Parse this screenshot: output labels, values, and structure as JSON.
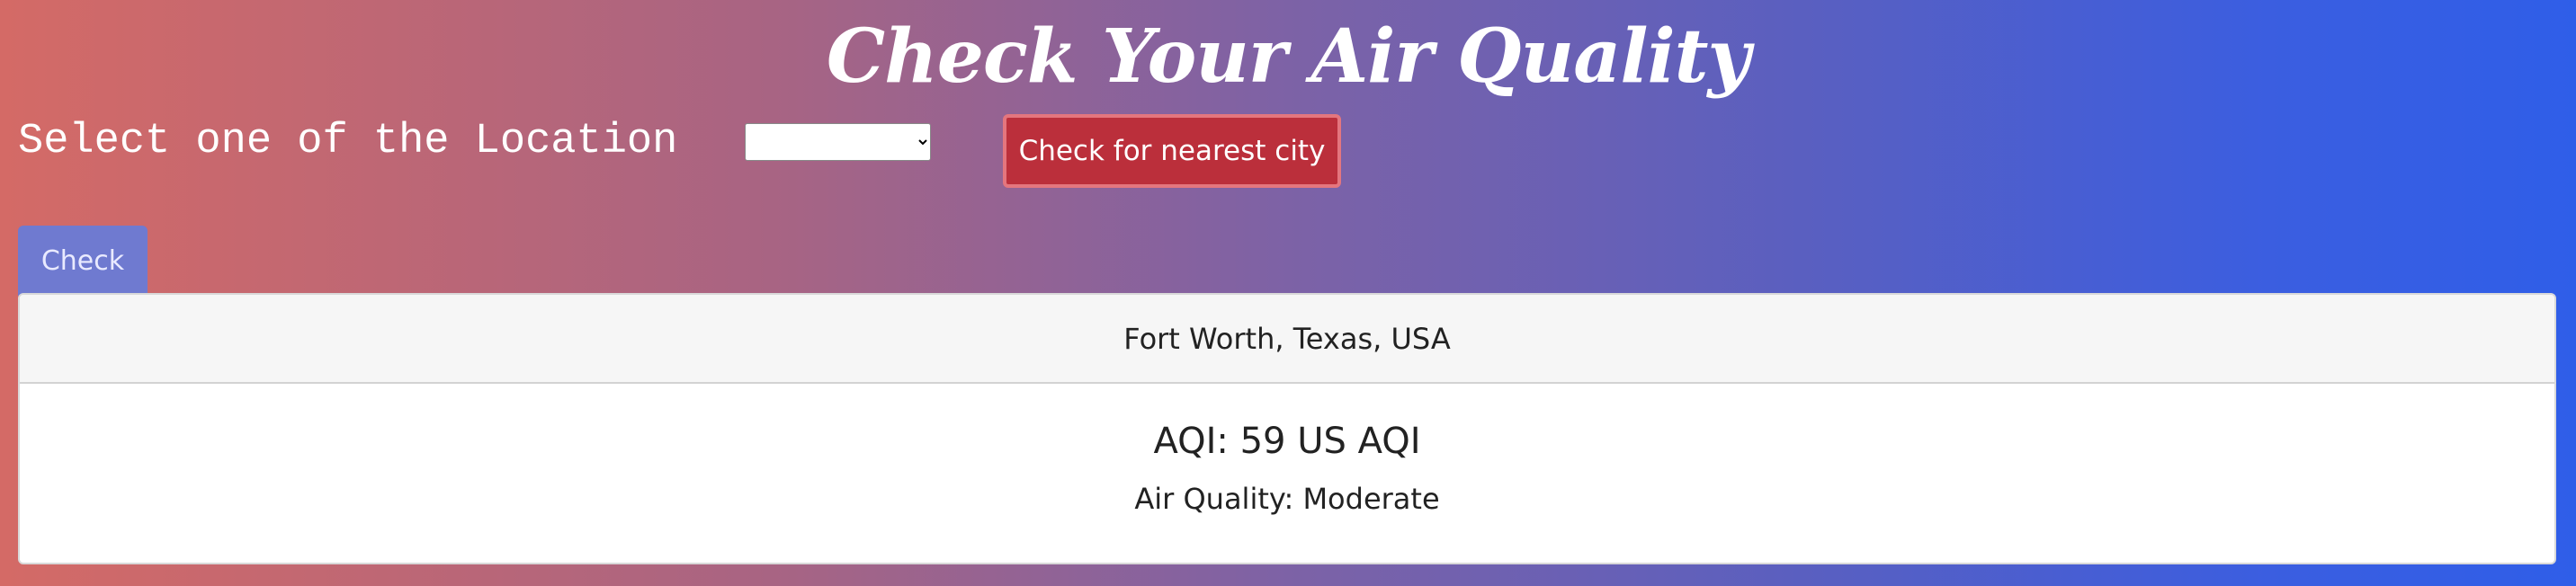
{
  "page": {
    "title": "Check Your Air Quality"
  },
  "controls": {
    "location_label": "Select one of the Location",
    "location_select": {
      "selected": "",
      "options": [
        ""
      ]
    },
    "nearest_button_label": "Check for nearest city",
    "check_button_label": "Check"
  },
  "result": {
    "location": "Fort Worth, Texas, USA",
    "aqi_text": "AQI: 59 US AQI",
    "quality_text": "Air Quality: Moderate"
  },
  "colors": {
    "gradient_start": "#d46a66",
    "gradient_end": "#2f5ee8",
    "nearest_button": "#bb2f3b",
    "check_button": "#6f7ad0"
  }
}
